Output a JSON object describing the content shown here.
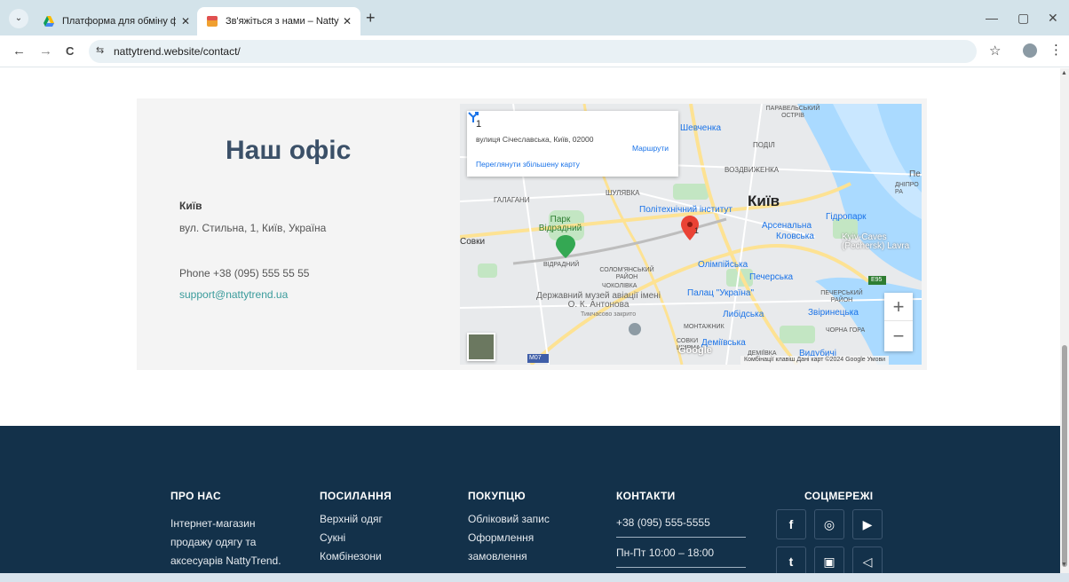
{
  "browser": {
    "tabs": [
      {
        "title": "Платформа для обміну файлам",
        "close": "✕"
      },
      {
        "title": "Зв'яжіться з нами – NattyTrend",
        "close": "✕"
      }
    ],
    "new_tab": "+",
    "tab_menu": "⌄",
    "url": "nattytrend.website/contact/",
    "controls": {
      "minimize": "—",
      "restore": "▢",
      "close": "✕"
    },
    "nav": {
      "back": "←",
      "forward": "→",
      "reload": "C"
    },
    "star": "☆",
    "menu": "⋮",
    "site_info": "⇆"
  },
  "office": {
    "title": "Наш офіс",
    "city": "Київ",
    "address": "вул. Стильна, 1, Київ, Україна",
    "phone": "Phone +38 (095) 555 55 55",
    "email": "support@nattytrend.ua"
  },
  "map": {
    "card": {
      "number": "1",
      "address": "вулиця Січеславська, Київ, 02000",
      "route": "Маршрути",
      "larger": "Переглянути збільшену карту"
    },
    "zoom_in": "+",
    "zoom_out": "−",
    "footer": "Комбінації клавіш   Дані карт ©2024 Google   Умови",
    "google": "Google",
    "labels": {
      "kyiv": "Київ",
      "shevchenka": "Шевченка",
      "podil": "ПОДІЛ",
      "vozdvyzhenka": "ВОЗДВИЖЕНКА",
      "halahany": "ГАЛАГАНИ",
      "shuliavka": "ШУЛЯВКА",
      "polytechnic": "Політехнічний інститут",
      "park": "Парк Відрадний",
      "sovky": "Совки",
      "vidradnyi": "ВІДРАДНИЙ",
      "solomianskyi": "СОЛОМ'ЯНСЬКИЙ РАЙОН",
      "chokolivka": "ЧОКОЛІВКА",
      "museum": "Державний музей авіації імені О. К. Антонова",
      "closed": "Тимчасово закрито",
      "arsenalna": "Арсенальна",
      "klovska": "Кловська",
      "hidropark": "Гідропарк",
      "caves": "Kyiv-Caves (Pechersk) Lavra",
      "olimpiiska": "Олімпійська",
      "pecherska": "Печерська",
      "palace": "Палац \"Україна\"",
      "pecherskyi": "ПЕЧЕРСЬКИЙ РАЙОН",
      "lybidska": "Либідська",
      "zvirynetska": "Звіринецька",
      "montazhnyk": "МОНТАЖНИК",
      "chorna_hora": "ЧОРНА ГОРА",
      "demiivska": "Деміївська",
      "vydubychi": "Видубичі",
      "sovky_shyrma": "СОВКИ ШИРМА",
      "demiivka": "ДЕМІЇВКА",
      "m07": "M07",
      "e95": "E95",
      "dnipro": "ДНІПРО РА",
      "pe": "Пе",
      "marker": "1",
      "vidradnyi_top": "ПАРАВЕЛЬСЬКИЙ ОСТРІВ"
    },
    "colors": {
      "water": "#aadaff",
      "road": "#ffffff",
      "major_road": "#fde293",
      "park": "#c3e6c3",
      "land": "#e8eaec",
      "marker": "#ea4335"
    }
  },
  "footer": {
    "about": {
      "title": "ПРО НАС",
      "lines": [
        "Інтернет-магазин",
        "продажу одягу та",
        "аксесуарів NattyTrend."
      ]
    },
    "links": {
      "title": "ПОСИЛАННЯ",
      "items": [
        "Верхній одяг",
        "Сукні",
        "Комбінезони"
      ]
    },
    "customer": {
      "title": "ПОКУПЦЮ",
      "items": [
        "Обліковий запис",
        "Оформлення",
        "замовлення"
      ]
    },
    "contacts": {
      "title": "КОНТАКТИ",
      "phone": "+38 (095) 555-5555",
      "hours": "Пн-Пт 10:00 – 18:00"
    },
    "social": {
      "title": "СОЦМЕРЕЖІ",
      "icons": [
        "facebook-icon",
        "instagram-icon",
        "youtube-icon",
        "twitter-icon",
        "viber-icon",
        "telegram-icon"
      ],
      "glyphs": [
        "f",
        "◎",
        "▶",
        "t",
        "▣",
        "◁"
      ]
    },
    "colors": {
      "bg": "#13314a"
    }
  }
}
